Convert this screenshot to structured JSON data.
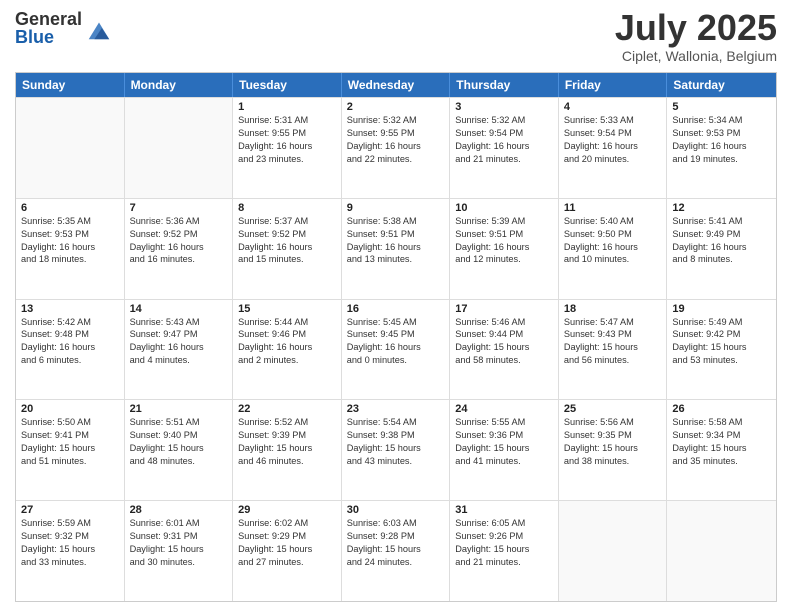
{
  "logo": {
    "general": "General",
    "blue": "Blue"
  },
  "title": "July 2025",
  "subtitle": "Ciplet, Wallonia, Belgium",
  "header_days": [
    "Sunday",
    "Monday",
    "Tuesday",
    "Wednesday",
    "Thursday",
    "Friday",
    "Saturday"
  ],
  "rows": [
    [
      {
        "day": "",
        "lines": [],
        "empty": true
      },
      {
        "day": "",
        "lines": [],
        "empty": true
      },
      {
        "day": "1",
        "lines": [
          "Sunrise: 5:31 AM",
          "Sunset: 9:55 PM",
          "Daylight: 16 hours",
          "and 23 minutes."
        ]
      },
      {
        "day": "2",
        "lines": [
          "Sunrise: 5:32 AM",
          "Sunset: 9:55 PM",
          "Daylight: 16 hours",
          "and 22 minutes."
        ]
      },
      {
        "day": "3",
        "lines": [
          "Sunrise: 5:32 AM",
          "Sunset: 9:54 PM",
          "Daylight: 16 hours",
          "and 21 minutes."
        ]
      },
      {
        "day": "4",
        "lines": [
          "Sunrise: 5:33 AM",
          "Sunset: 9:54 PM",
          "Daylight: 16 hours",
          "and 20 minutes."
        ]
      },
      {
        "day": "5",
        "lines": [
          "Sunrise: 5:34 AM",
          "Sunset: 9:53 PM",
          "Daylight: 16 hours",
          "and 19 minutes."
        ]
      }
    ],
    [
      {
        "day": "6",
        "lines": [
          "Sunrise: 5:35 AM",
          "Sunset: 9:53 PM",
          "Daylight: 16 hours",
          "and 18 minutes."
        ]
      },
      {
        "day": "7",
        "lines": [
          "Sunrise: 5:36 AM",
          "Sunset: 9:52 PM",
          "Daylight: 16 hours",
          "and 16 minutes."
        ]
      },
      {
        "day": "8",
        "lines": [
          "Sunrise: 5:37 AM",
          "Sunset: 9:52 PM",
          "Daylight: 16 hours",
          "and 15 minutes."
        ]
      },
      {
        "day": "9",
        "lines": [
          "Sunrise: 5:38 AM",
          "Sunset: 9:51 PM",
          "Daylight: 16 hours",
          "and 13 minutes."
        ]
      },
      {
        "day": "10",
        "lines": [
          "Sunrise: 5:39 AM",
          "Sunset: 9:51 PM",
          "Daylight: 16 hours",
          "and 12 minutes."
        ]
      },
      {
        "day": "11",
        "lines": [
          "Sunrise: 5:40 AM",
          "Sunset: 9:50 PM",
          "Daylight: 16 hours",
          "and 10 minutes."
        ]
      },
      {
        "day": "12",
        "lines": [
          "Sunrise: 5:41 AM",
          "Sunset: 9:49 PM",
          "Daylight: 16 hours",
          "and 8 minutes."
        ]
      }
    ],
    [
      {
        "day": "13",
        "lines": [
          "Sunrise: 5:42 AM",
          "Sunset: 9:48 PM",
          "Daylight: 16 hours",
          "and 6 minutes."
        ]
      },
      {
        "day": "14",
        "lines": [
          "Sunrise: 5:43 AM",
          "Sunset: 9:47 PM",
          "Daylight: 16 hours",
          "and 4 minutes."
        ]
      },
      {
        "day": "15",
        "lines": [
          "Sunrise: 5:44 AM",
          "Sunset: 9:46 PM",
          "Daylight: 16 hours",
          "and 2 minutes."
        ]
      },
      {
        "day": "16",
        "lines": [
          "Sunrise: 5:45 AM",
          "Sunset: 9:45 PM",
          "Daylight: 16 hours",
          "and 0 minutes."
        ]
      },
      {
        "day": "17",
        "lines": [
          "Sunrise: 5:46 AM",
          "Sunset: 9:44 PM",
          "Daylight: 15 hours",
          "and 58 minutes."
        ]
      },
      {
        "day": "18",
        "lines": [
          "Sunrise: 5:47 AM",
          "Sunset: 9:43 PM",
          "Daylight: 15 hours",
          "and 56 minutes."
        ]
      },
      {
        "day": "19",
        "lines": [
          "Sunrise: 5:49 AM",
          "Sunset: 9:42 PM",
          "Daylight: 15 hours",
          "and 53 minutes."
        ]
      }
    ],
    [
      {
        "day": "20",
        "lines": [
          "Sunrise: 5:50 AM",
          "Sunset: 9:41 PM",
          "Daylight: 15 hours",
          "and 51 minutes."
        ]
      },
      {
        "day": "21",
        "lines": [
          "Sunrise: 5:51 AM",
          "Sunset: 9:40 PM",
          "Daylight: 15 hours",
          "and 48 minutes."
        ]
      },
      {
        "day": "22",
        "lines": [
          "Sunrise: 5:52 AM",
          "Sunset: 9:39 PM",
          "Daylight: 15 hours",
          "and 46 minutes."
        ]
      },
      {
        "day": "23",
        "lines": [
          "Sunrise: 5:54 AM",
          "Sunset: 9:38 PM",
          "Daylight: 15 hours",
          "and 43 minutes."
        ]
      },
      {
        "day": "24",
        "lines": [
          "Sunrise: 5:55 AM",
          "Sunset: 9:36 PM",
          "Daylight: 15 hours",
          "and 41 minutes."
        ]
      },
      {
        "day": "25",
        "lines": [
          "Sunrise: 5:56 AM",
          "Sunset: 9:35 PM",
          "Daylight: 15 hours",
          "and 38 minutes."
        ]
      },
      {
        "day": "26",
        "lines": [
          "Sunrise: 5:58 AM",
          "Sunset: 9:34 PM",
          "Daylight: 15 hours",
          "and 35 minutes."
        ]
      }
    ],
    [
      {
        "day": "27",
        "lines": [
          "Sunrise: 5:59 AM",
          "Sunset: 9:32 PM",
          "Daylight: 15 hours",
          "and 33 minutes."
        ]
      },
      {
        "day": "28",
        "lines": [
          "Sunrise: 6:01 AM",
          "Sunset: 9:31 PM",
          "Daylight: 15 hours",
          "and 30 minutes."
        ]
      },
      {
        "day": "29",
        "lines": [
          "Sunrise: 6:02 AM",
          "Sunset: 9:29 PM",
          "Daylight: 15 hours",
          "and 27 minutes."
        ]
      },
      {
        "day": "30",
        "lines": [
          "Sunrise: 6:03 AM",
          "Sunset: 9:28 PM",
          "Daylight: 15 hours",
          "and 24 minutes."
        ]
      },
      {
        "day": "31",
        "lines": [
          "Sunrise: 6:05 AM",
          "Sunset: 9:26 PM",
          "Daylight: 15 hours",
          "and 21 minutes."
        ]
      },
      {
        "day": "",
        "lines": [],
        "empty": true
      },
      {
        "day": "",
        "lines": [],
        "empty": true
      }
    ]
  ]
}
